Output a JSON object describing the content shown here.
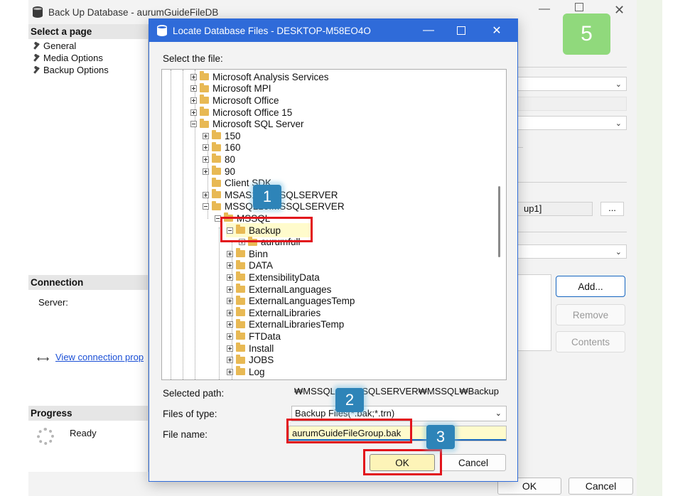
{
  "background_window": {
    "title": "Back Up Database - aurumGuideFileDB",
    "select_page_header": "Select a page",
    "pages": [
      "General",
      "Media Options",
      "Backup Options"
    ],
    "connection_header": "Connection",
    "server_label": "Server:",
    "view_connection_link": "View connection prop",
    "progress_header": "Progress",
    "progress_status": "Ready",
    "destination_partial": "up1]",
    "browse_button": "...",
    "add_button": "Add...",
    "remove_button": "Remove",
    "contents_button": "Contents",
    "ok_button": "OK",
    "cancel_button": "Cancel"
  },
  "step_badge_top": "5",
  "dialog": {
    "title": "Locate Database Files - DESKTOP-M58EO4O",
    "select_file_label": "Select the file:",
    "tree": [
      {
        "label": "Microsoft Analysis Services",
        "level": 0,
        "state": "collapsed"
      },
      {
        "label": "Microsoft MPI",
        "level": 0,
        "state": "collapsed"
      },
      {
        "label": "Microsoft Office",
        "level": 0,
        "state": "collapsed"
      },
      {
        "label": "Microsoft Office 15",
        "level": 0,
        "state": "collapsed"
      },
      {
        "label": "Microsoft SQL Server",
        "level": 0,
        "state": "expanded"
      },
      {
        "label": "150",
        "level": 1,
        "state": "collapsed"
      },
      {
        "label": "160",
        "level": 1,
        "state": "collapsed"
      },
      {
        "label": "80",
        "level": 1,
        "state": "collapsed"
      },
      {
        "label": "90",
        "level": 1,
        "state": "collapsed"
      },
      {
        "label": "Client SDK",
        "level": 1,
        "state": "leaf"
      },
      {
        "label": "MSAS16.MSSQLSERVER",
        "level": 1,
        "state": "collapsed"
      },
      {
        "label": "MSSQL16.MSSQLSERVER",
        "level": 1,
        "state": "expanded"
      },
      {
        "label": "MSSQL",
        "level": 2,
        "state": "expanded"
      },
      {
        "label": "Backup",
        "level": 3,
        "state": "expanded"
      },
      {
        "label": "aurumfull",
        "level": 4,
        "state": "collapsed"
      },
      {
        "label": "Binn",
        "level": 3,
        "state": "collapsed"
      },
      {
        "label": "DATA",
        "level": 3,
        "state": "collapsed"
      },
      {
        "label": "ExtensibilityData",
        "level": 3,
        "state": "collapsed"
      },
      {
        "label": "ExternalLanguages",
        "level": 3,
        "state": "collapsed"
      },
      {
        "label": "ExternalLanguagesTemp",
        "level": 3,
        "state": "collapsed"
      },
      {
        "label": "ExternalLibraries",
        "level": 3,
        "state": "collapsed"
      },
      {
        "label": "ExternalLibrariesTemp",
        "level": 3,
        "state": "collapsed"
      },
      {
        "label": "FTData",
        "level": 3,
        "state": "collapsed"
      },
      {
        "label": "Install",
        "level": 3,
        "state": "collapsed"
      },
      {
        "label": "JOBS",
        "level": 3,
        "state": "collapsed"
      },
      {
        "label": "Log",
        "level": 3,
        "state": "collapsed"
      }
    ],
    "selected_path_label": "Selected path:",
    "selected_path_value": "₩MSSQL16.MSSQLSERVER₩MSSQL₩Backup",
    "files_of_type_label": "Files of type:",
    "files_of_type_value": "Backup Files(*.bak;*.trn)",
    "file_name_label": "File name:",
    "file_name_value": "aurumGuideFileGroup.bak",
    "ok_button": "OK",
    "cancel_button": "Cancel"
  },
  "step_badges": [
    "1",
    "2",
    "3"
  ]
}
